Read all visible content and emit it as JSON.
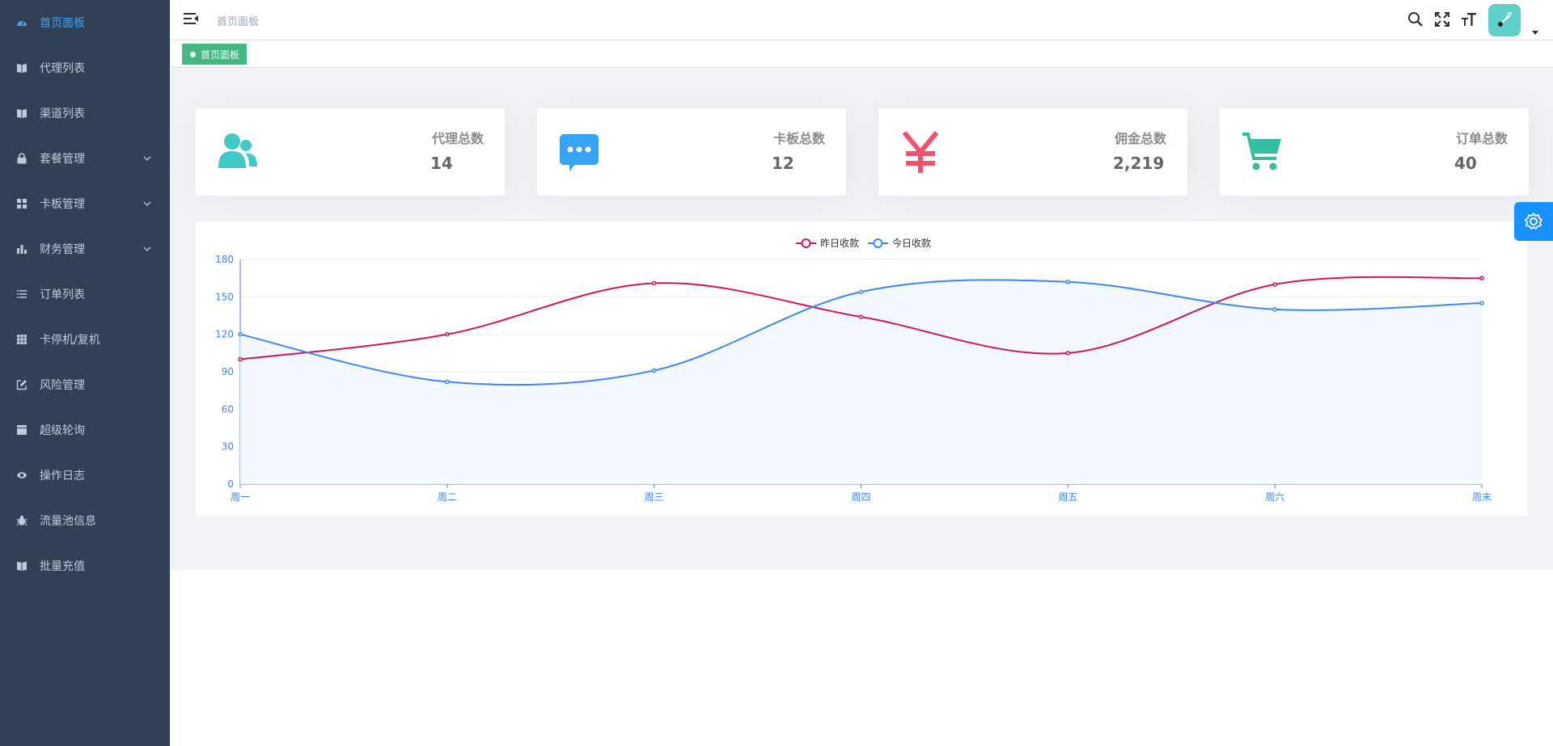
{
  "sidebar": {
    "items": [
      {
        "label": "首页面板",
        "icon": "dashboard-icon",
        "active": true,
        "expandable": false
      },
      {
        "label": "代理列表",
        "icon": "book-icon",
        "active": false,
        "expandable": false
      },
      {
        "label": "渠道列表",
        "icon": "book-icon",
        "active": false,
        "expandable": false
      },
      {
        "label": "套餐管理",
        "icon": "lock-icon",
        "active": false,
        "expandable": true
      },
      {
        "label": "卡板管理",
        "icon": "grid-icon",
        "active": false,
        "expandable": true
      },
      {
        "label": "财务管理",
        "icon": "bar-chart-icon",
        "active": false,
        "expandable": true
      },
      {
        "label": "订单列表",
        "icon": "list-icon",
        "active": false,
        "expandable": false
      },
      {
        "label": "卡停机/复机",
        "icon": "table-icon",
        "active": false,
        "expandable": false
      },
      {
        "label": "风险管理",
        "icon": "edit-icon",
        "active": false,
        "expandable": false
      },
      {
        "label": "超级轮询",
        "icon": "clapperboard-icon",
        "active": false,
        "expandable": false
      },
      {
        "label": "操作日志",
        "icon": "eye-icon",
        "active": false,
        "expandable": false
      },
      {
        "label": "流量池信息",
        "icon": "bug-icon",
        "active": false,
        "expandable": false
      },
      {
        "label": "批量充值",
        "icon": "book-icon",
        "active": false,
        "expandable": false
      }
    ]
  },
  "navbar": {
    "breadcrumb": "首页面板",
    "icons": [
      "search-icon",
      "fullscreen-icon",
      "font-size-icon"
    ]
  },
  "tags": {
    "active_tag": "首页面板"
  },
  "cards": [
    {
      "title": "代理总数",
      "value": "14",
      "icon": "peoples-icon",
      "color": "#40c9c6"
    },
    {
      "title": "卡板总数",
      "value": "12",
      "icon": "message-icon",
      "color": "#36a3f7"
    },
    {
      "title": "佣金总数",
      "value": "2,219",
      "icon": "money-icon",
      "color": "#f4516c"
    },
    {
      "title": "订单总数",
      "value": "40",
      "icon": "shopping-cart-icon",
      "color": "#34bfa3"
    }
  ],
  "colors": {
    "sidebar_bg": "#304156",
    "active_menu": "#409eff",
    "tag_green": "#42b983",
    "settings_blue": "#1890ff"
  },
  "chart_data": {
    "type": "line",
    "categories": [
      "周一",
      "周二",
      "周三",
      "周四",
      "周五",
      "周六",
      "周末"
    ],
    "series": [
      {
        "name": "昨日收款",
        "values": [
          100,
          120,
          161,
          134,
          105,
          160,
          165
        ],
        "color": "#d4145a",
        "smooth": true,
        "area": false
      },
      {
        "name": "今日收款",
        "values": [
          120,
          82,
          91,
          154,
          162,
          140,
          145
        ],
        "color": "#3888fa",
        "smooth": true,
        "area": true,
        "area_color": "#f3f8ff"
      }
    ],
    "ylim": [
      0,
      180
    ],
    "yticks": [
      0,
      30,
      60,
      90,
      120,
      150,
      180
    ],
    "legend": "top-center",
    "grid": true
  }
}
